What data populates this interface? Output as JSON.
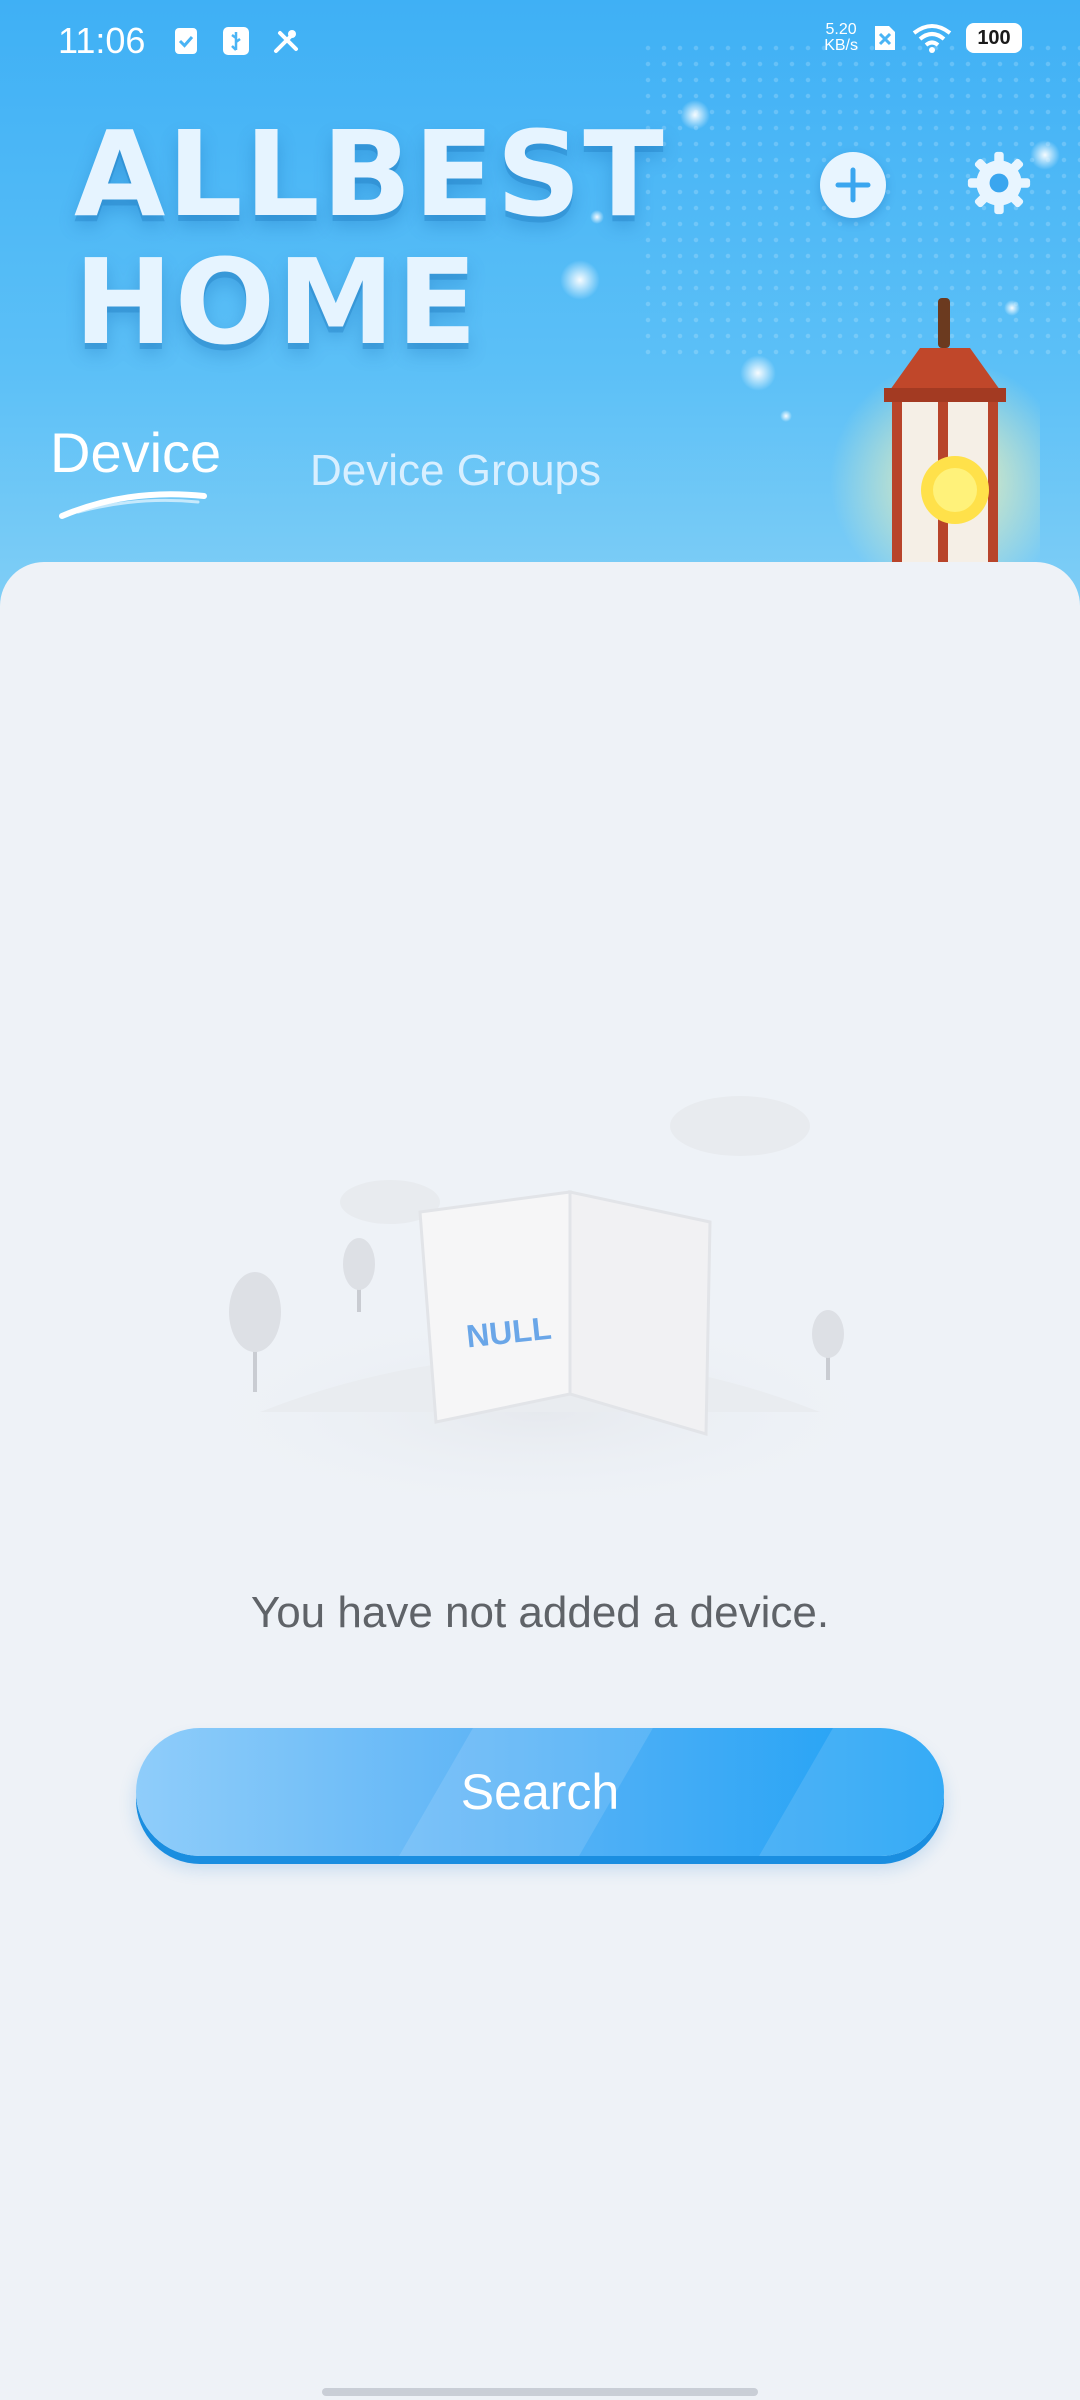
{
  "status_bar": {
    "time": "11:06",
    "net_speed_value": "5.20",
    "net_speed_unit": "KB/s",
    "battery": "100",
    "left_icons": [
      "checklist-icon",
      "usb-debug-icon",
      "tools-icon"
    ],
    "right_icons": [
      "sim-off-icon",
      "wifi-icon",
      "battery-icon"
    ]
  },
  "header": {
    "title_line1": "ALLBEST",
    "title_line2": "HOME",
    "add_icon": "plus-icon",
    "settings_icon": "gear-icon"
  },
  "tabs": [
    {
      "label": "Device",
      "active": true
    },
    {
      "label": "Device Groups",
      "active": false
    }
  ],
  "empty_state": {
    "illustration_text": "NULL",
    "message": "You have not added a device."
  },
  "actions": {
    "search_label": "Search"
  },
  "colors": {
    "header_blue": "#3fb0f5",
    "button_blue": "#1aa0f5",
    "background": "#eef2f7",
    "message_text": "#5f6368"
  }
}
